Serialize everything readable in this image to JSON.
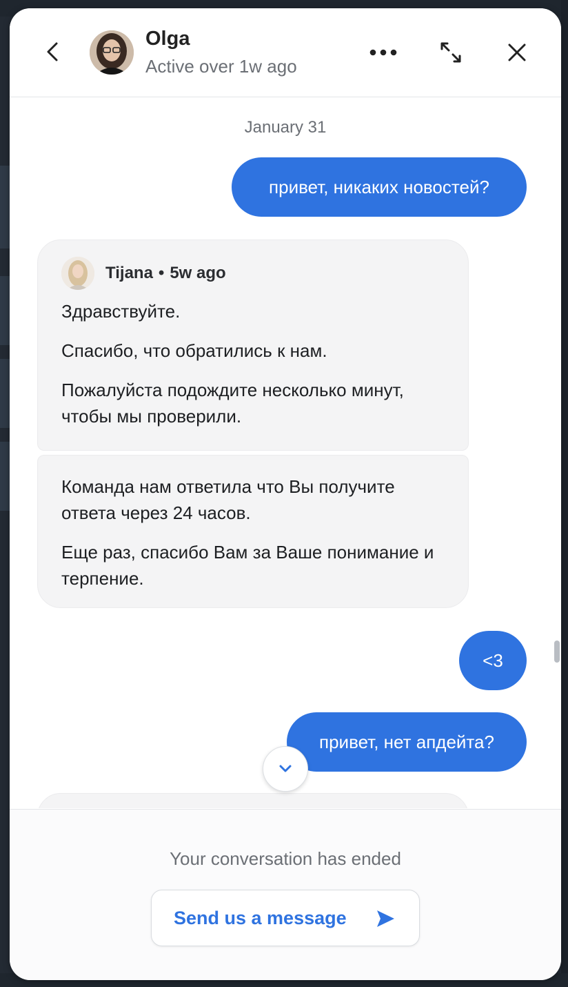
{
  "header": {
    "name": "Olga",
    "status": "Active over 1w ago",
    "icons": [
      "chevron-left-icon",
      "more-horizontal-icon",
      "expand-icon",
      "close-icon"
    ]
  },
  "conversation": {
    "date": "January 31",
    "outgoing_1": "привет, никаких новостей?",
    "incoming_1": {
      "sender": "Tijana",
      "time": "5w ago",
      "separator": "•",
      "paragraphs": [
        "Здравствуйте.",
        "Спасибо, что обратились к нам.",
        "Пожалуйста подождите несколько минут, чтобы мы проверили."
      ]
    },
    "incoming_2": {
      "paragraphs": [
        "Команда нам ответила что Вы получите ответа через 24 часов.",
        "Еще раз, спасибо Вам за Ваше понимание и терпение."
      ]
    },
    "outgoing_2": "<3",
    "outgoing_3": "привет, нет апдейта?"
  },
  "footer": {
    "ended_text": "Your conversation has ended",
    "send_label": "Send us a message"
  },
  "colors": {
    "accent": "#2f73e0",
    "incoming_bg": "#f4f4f5"
  }
}
